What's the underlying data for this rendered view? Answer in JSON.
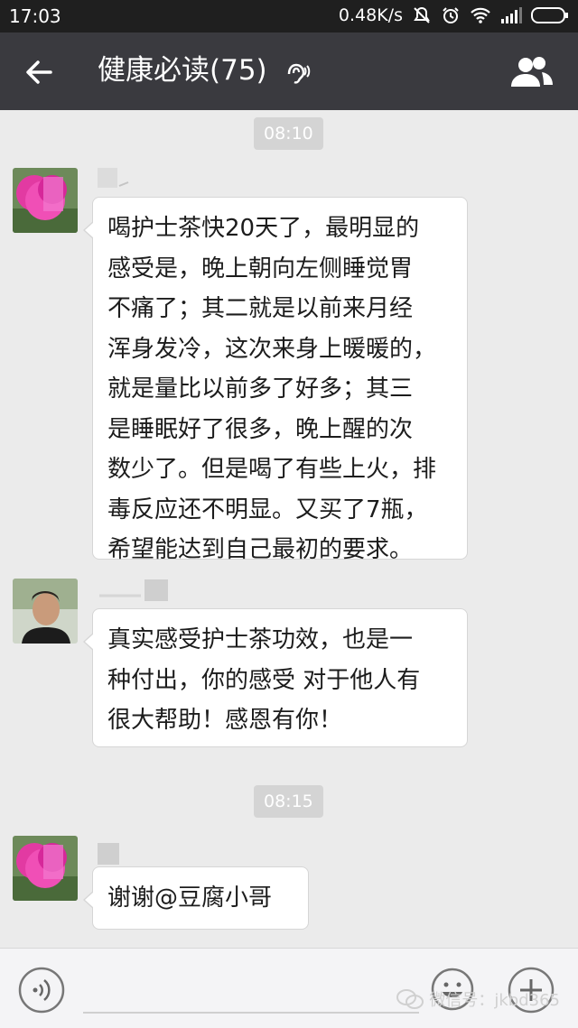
{
  "status_bar": {
    "time": "17:03",
    "network_speed": "0.48K/s",
    "icons": [
      "mute-icon",
      "alarm-icon",
      "wifi-icon",
      "signal-icon",
      "battery-icon"
    ]
  },
  "header": {
    "title": "健康必读(75)",
    "icons": [
      "back-arrow-icon",
      "earpiece-icon",
      "group-members-icon"
    ]
  },
  "timestamps": [
    "08:10",
    "08:15"
  ],
  "messages": [
    {
      "text": "喝护士茶快20天了，最明显的\n感受是，晚上朝向左侧睡觉胃\n不痛了；其二就是以前来月经\n浑身发冷，这次来身上暖暖的，\n就是量比以前多了好多；其三\n是睡眠好了很多，晚上醒的次\n数少了。但是喝了有些上火，排\n毒反应还不明显。又买了7瓶，\n希望能达到自己最初的要求。"
    },
    {
      "text": "真实感受护士茶功效，也是一\n种付出，你的感受 对于他人有\n很大帮助！感恩有你！"
    },
    {
      "text": "谢谢@豆腐小哥"
    }
  ],
  "input_bar": {
    "icons": [
      "voice-icon",
      "emoji-icon",
      "plus-icon"
    ]
  },
  "watermark": {
    "text": "微信号：jkbd365"
  },
  "colors": {
    "status_bar_bg": "#1f1f1f",
    "header_bg": "#3a3a3f",
    "chat_bg": "#ebebeb",
    "bubble_bg": "#ffffff",
    "timestamp_bg": "#d4d4d4"
  }
}
